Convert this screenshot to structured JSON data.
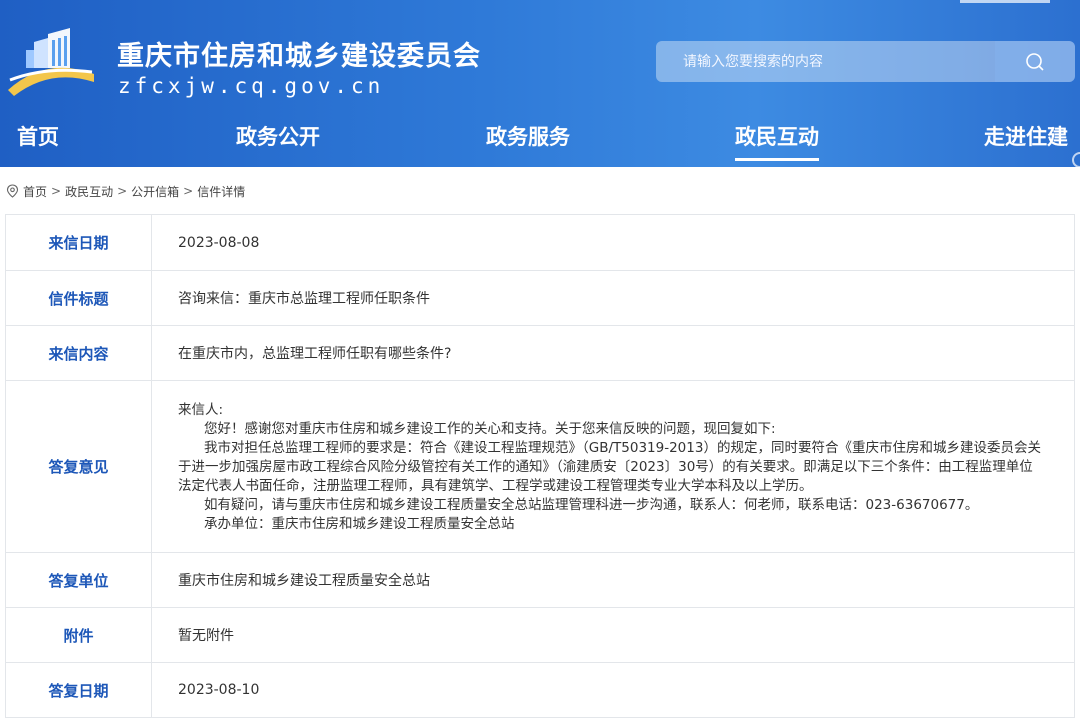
{
  "header": {
    "title": "重庆市住房和城乡建设委员会",
    "domain": "zfcxjw.cq.gov.cn",
    "search_placeholder": "请输入您要搜索的内容",
    "colors": {
      "primary": "#2f7ad8",
      "label_text": "#1d57b8"
    }
  },
  "nav": {
    "items": [
      "首页",
      "政务公开",
      "政务服务",
      "政民互动",
      "走进住建"
    ],
    "active": "政民互动"
  },
  "breadcrumb": [
    "首页",
    "政民互动",
    "公开信箱",
    "信件详情"
  ],
  "letter": {
    "rows": [
      {
        "label": "来信日期",
        "value": "2023-08-08"
      },
      {
        "label": "信件标题",
        "value": "咨询来信：重庆市总监理工程师任职条件"
      },
      {
        "label": "来信内容",
        "value": "在重庆市内，总监理工程师任职有哪些条件?"
      },
      {
        "label": "答复意见"
      },
      {
        "label": "答复单位",
        "value": "重庆市住房和城乡建设工程质量安全总站"
      },
      {
        "label": "附件",
        "value": "暂无附件"
      },
      {
        "label": "答复日期",
        "value": "2023-08-10"
      }
    ],
    "reply": [
      "来信人:",
      "您好！感谢您对重庆市住房和城乡建设工作的关心和支持。关于您来信反映的问题，现回复如下:",
      "我市对担任总监理工程师的要求是：符合《建设工程监理规范》（GB/T50319-2013）的规定，同时要符合《重庆市住房和城乡建设委员会关于进一步加强房屋市政工程综合风险分级管控有关工作的通知》（渝建质安〔2023〕30号）的有关要求。即满足以下三个条件：由工程监理单位法定代表人书面任命，注册监理工程师，具有建筑学、工程学或建设工程管理类专业大学本科及以上学历。",
      "如有疑问，请与重庆市住房和城乡建设工程质量安全总站监理管理科进一步沟通，联系人：何老师，联系电话：023-63670677。",
      "承办单位：重庆市住房和城乡建设工程质量安全总站"
    ]
  }
}
